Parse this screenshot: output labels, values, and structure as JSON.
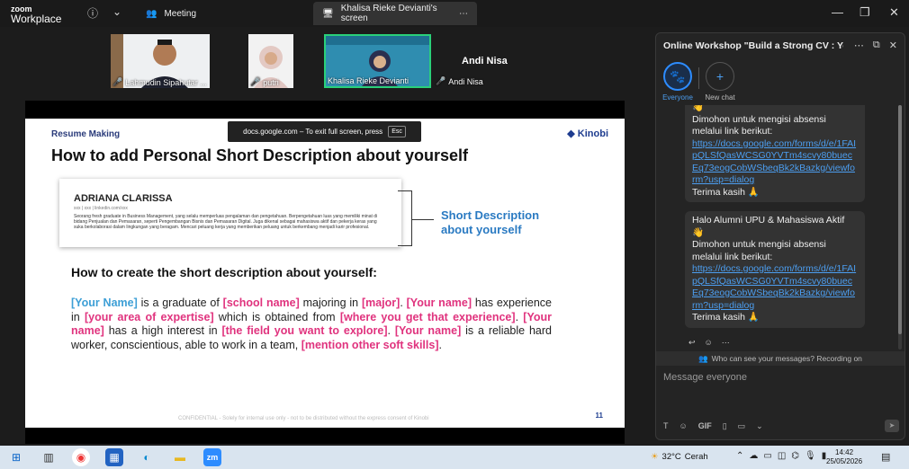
{
  "titlebar": {
    "logo_top": "zoom",
    "logo_bottom": "Workplace",
    "meeting_tab": "Meeting",
    "share_tab": "Khalisa Rieke Devianti's screen",
    "icons": [
      "info-icon",
      "chevron-down-icon",
      "people-icon",
      "more-icon",
      "minimize-icon",
      "restore-icon",
      "close-icon"
    ]
  },
  "participants": [
    {
      "name": "Lahmudin Sipahutar ...",
      "muted": true
    },
    {
      "name": "putri",
      "muted": true
    },
    {
      "name": "Khalisa Rieke Devianti",
      "muted": false
    },
    {
      "name": "Andi Nisa",
      "muted": true
    }
  ],
  "speaker_label": "Andi Nisa",
  "share_banner": {
    "text": "docs.google.com – To exit full screen, press",
    "key": "Esc"
  },
  "slide": {
    "topic": "Resume Making",
    "brand": "Kinobi",
    "title": "How to add Personal Short Description about yourself",
    "resume_name": "ADRIANA CLARISSA",
    "resume_contact": "xxx | xxx | linkedin.com/xxx",
    "resume_desc": "Seorang fresh graduate in Business Management, yang selalu memperluas pengalaman dan pengetahuan. Berpengetahuan luas yang memiliki minat di bidang Penjualan dan Pemasaran, seperti Pengembangan Bisnis dan Pemasaran Digital. Juga dikenal sebagai mahasiswa aktif dan pekerja keras yang suka berkolaborasi dalam lingkungan yang beragam. Mencari peluang kerja yang memberikan peluang untuk berkembang menjadi karir profesional.",
    "callout_line1": "Short Description",
    "callout_line2": "about yourself",
    "subhead": "How to create the short description about yourself:",
    "para": {
      "s1": "[Your Name]",
      "t1": " is a graduate of ",
      "s2": "[school name]",
      "t2": " majoring in ",
      "s3": "[major]",
      "t3": ". ",
      "s4": "[Your name]",
      "t4": " has experience in ",
      "s5": "[your area of expertise]",
      "t5": " which is obtained from ",
      "s6": "[where you get that experience]",
      "t6": ". ",
      "s7": "[Your name]",
      "t7": " has a high interest in ",
      "s8": "[the field you want to explore]",
      "t8": ". ",
      "s9": "[Your name]",
      "t9": " is a reliable hard worker, conscientious, able to work in a team, ",
      "s10": "[mention other soft skills]",
      "t10": "."
    },
    "footer": "CONFIDENTIAL - Solely for internal use only - not to be distributed without the express consent of Kinobi",
    "page_number": "11"
  },
  "chat": {
    "title": "Online Workshop \"Build a Strong CV : You...",
    "channels": [
      {
        "label": "Everyone",
        "icon": "paw-icon"
      },
      {
        "label": "New chat",
        "icon": "plus-icon"
      }
    ],
    "message1": {
      "emoji": "👋",
      "line1": "Dimohon untuk mengisi absensi melalui link berikut:",
      "link": "https://docs.google.com/forms/d/e/1FAIpQLSfQasWCSG0YVTm4scvy80buecEq73eogCobWSbeqBk2kBazkg/viewform?usp=dialog",
      "thanks": "Terima kasih 🙏"
    },
    "message2": {
      "greeting": "Halo Alumni UPU & Mahasiswa Aktif 👋",
      "line1": "Dimohon untuk mengisi absensi melalui link berikut:",
      "link": "https://docs.google.com/forms/d/e/1FAIpQLSfQasWCSG0YVTm4scvy80buecEq73eogCobWSbeqBk2kBazkg/viewform?usp=dialog",
      "thanks": "Terima kasih 🙏"
    },
    "recording_note": "Who can see your messages? Recording on",
    "input_placeholder": "Message everyone",
    "gif_label": "GIF"
  },
  "taskbar": {
    "weather_temp": "32°C",
    "weather_desc": "Cerah",
    "time": "14:42",
    "date": "25/05/2026",
    "apps": [
      "windows-start-icon",
      "task-view-icon",
      "chrome-icon",
      "store-icon",
      "edge-icon",
      "file-explorer-icon",
      "zoom-icon"
    ]
  }
}
